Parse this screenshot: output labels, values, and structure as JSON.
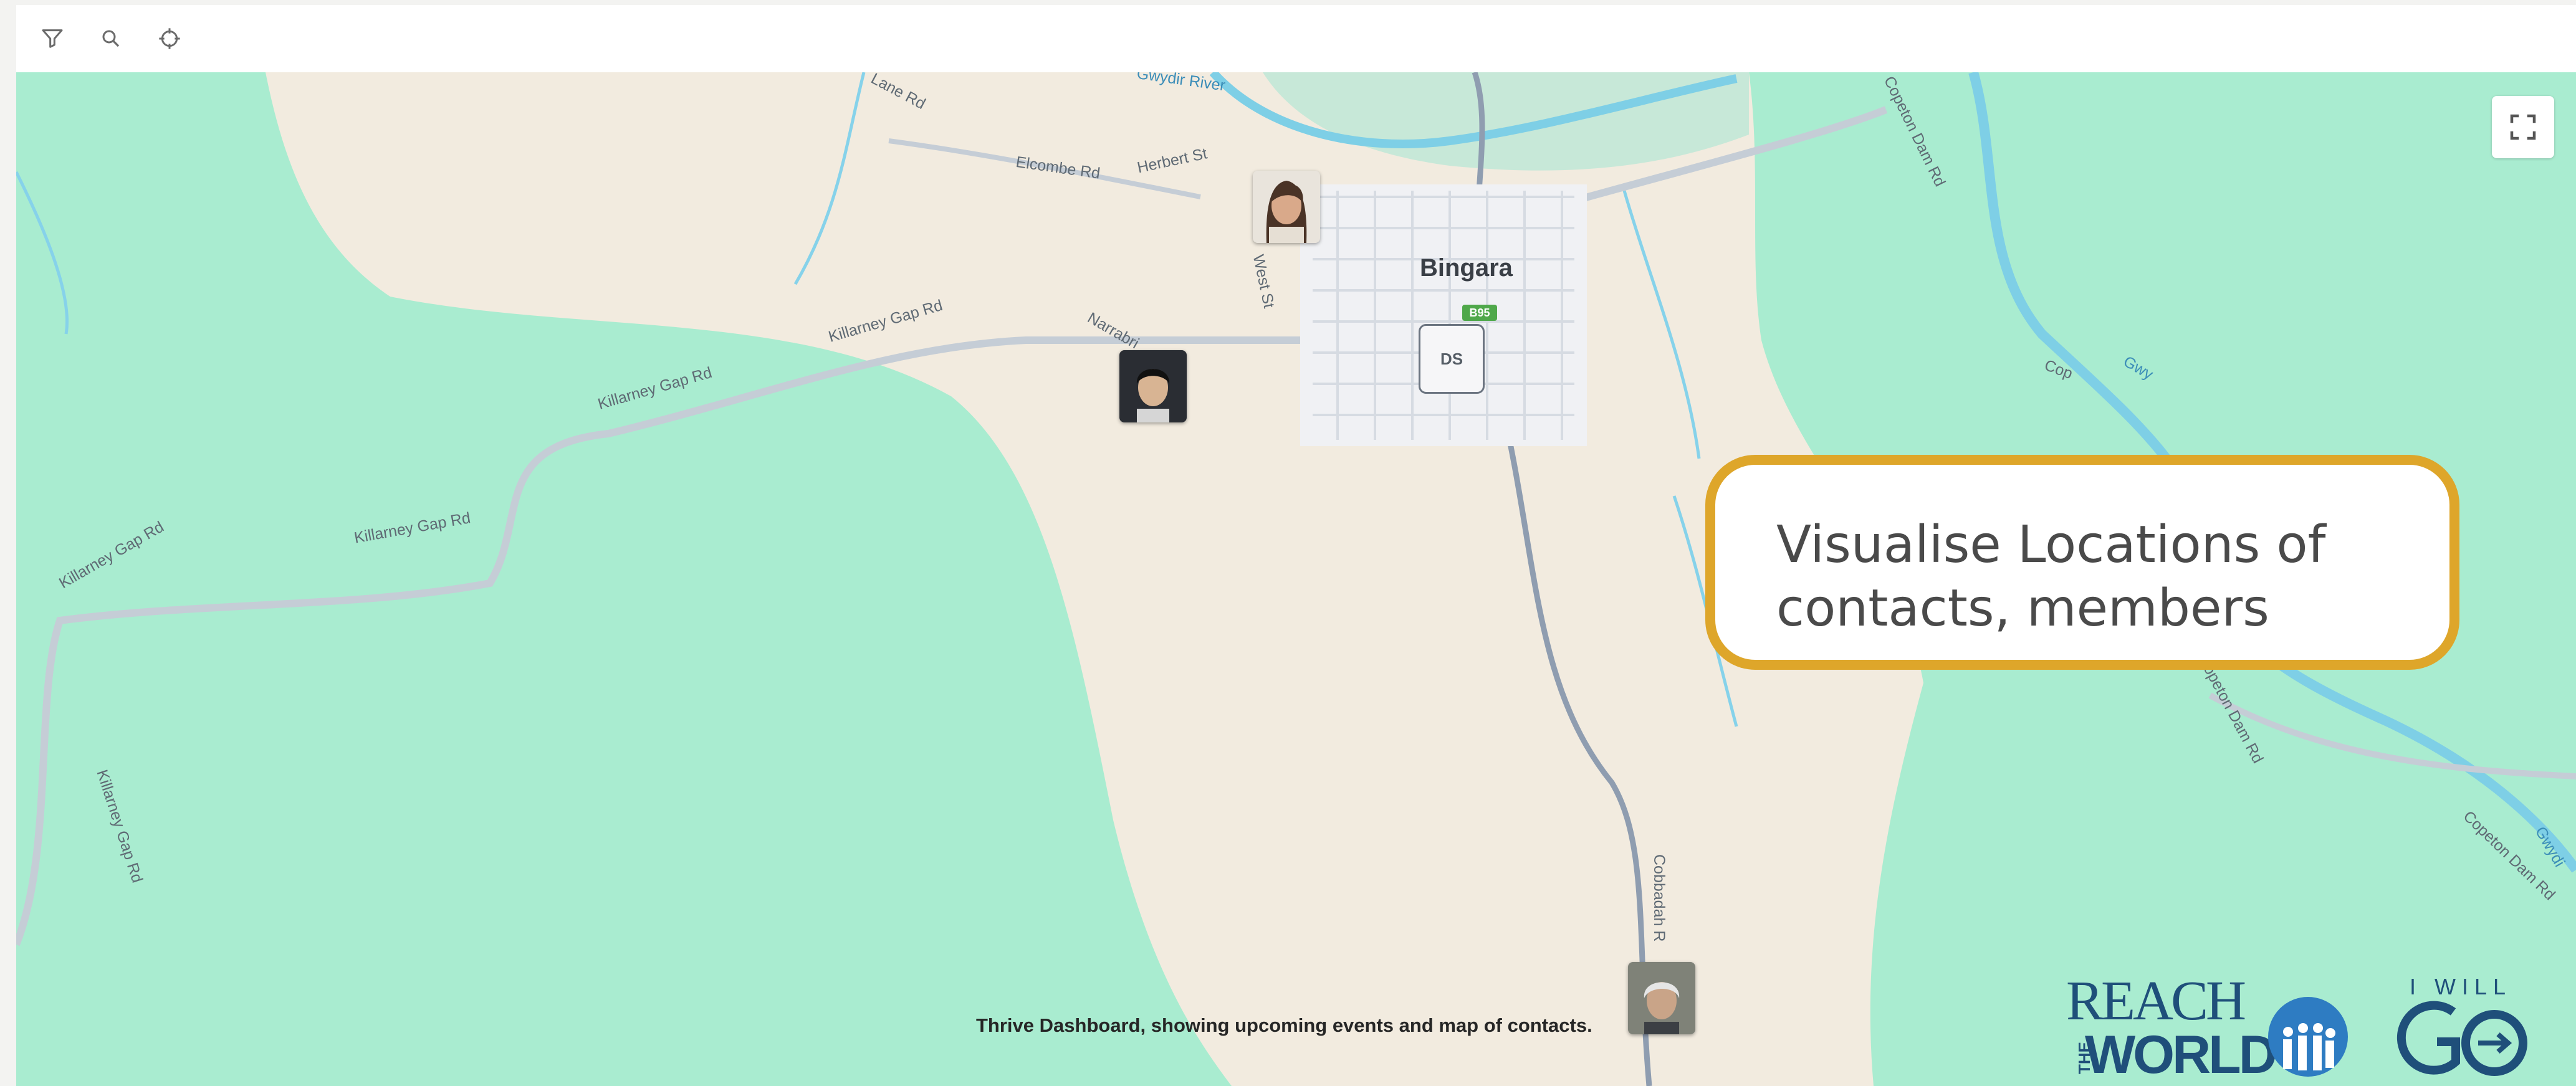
{
  "toolbar": {
    "icons": [
      "filter-icon",
      "search-icon",
      "locate-icon"
    ]
  },
  "map": {
    "town": "Bingara",
    "route_shield": "B95",
    "poi_badge": "DS",
    "roads": {
      "elcombe": "Elcombe Rd",
      "herbert": "Herbert St",
      "west": "West St",
      "narrabri": "Narrabri",
      "killarney_1": "Killarney Gap Rd",
      "killarney_2": "Killarney Gap Rd",
      "killarney_3": "Killarney Gap Rd",
      "killarney_4": "Killarney Gap Rd",
      "killarney_5": "Killarney Gap Rd",
      "copeton_1": "Copeton Dam Rd",
      "copeton_2": "Copeton Dam Rd",
      "copeton_3": "Copeton Dam Rd",
      "cobbadah": "Cobbadah R",
      "river_top": "Gwydir River",
      "road_top": "Lane Rd",
      "gwy": "Gwy",
      "cop": "Cop",
      "gwydir_right": "Gwydi"
    },
    "colors": {
      "land": "#f2ebdf",
      "forest": "#a9ecd0",
      "water": "#7ecfe6",
      "road": "#c5cdd6",
      "callout_border": "#dea62a"
    }
  },
  "callout": {
    "line1": "Visualise Locations of",
    "line2": "contacts, members"
  },
  "caption": "Thrive Dashboard, showing upcoming events and map of contacts.",
  "logos": {
    "reach_line1": "REACH",
    "reach_the": "THE",
    "reach_line2": "WORLD",
    "go_top": "I WILL",
    "go_main": "GO"
  }
}
